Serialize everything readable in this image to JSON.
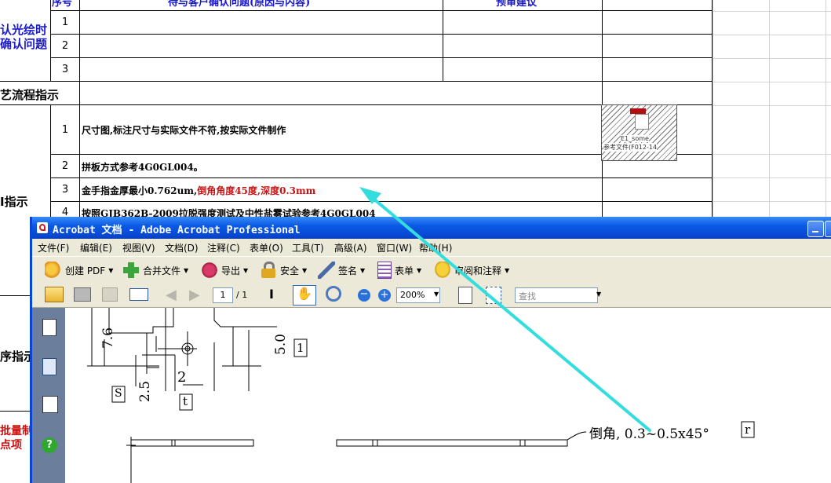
{
  "spreadsheet": {
    "header": {
      "seq_col": "序号",
      "question_col": "待与客户确认问题(原因与内容)",
      "suggestion_col": "预审建议"
    },
    "section_confirm": {
      "line1": "认光绘时",
      "line2": "确认问题"
    },
    "confirm_rows": [
      "1",
      "2",
      "3"
    ],
    "section_process": "艺流程指示",
    "process_rows": [
      {
        "num": "1",
        "text": "尺寸图,标注尺寸与实际文件不符,按实际文件制作"
      },
      {
        "num": "2",
        "text": "拼板方式参考4G0GL004。"
      },
      {
        "num": "3",
        "text_black": "金手指金厚最小0.762um,",
        "text_red": "倒角角度45度,深度0.3mm"
      },
      {
        "num": "4",
        "text": "按照GJB362B-2009拉脱强度测试及中性盐雾试验参考4G0GL004"
      }
    ],
    "section_mi": "I指示",
    "section_seq": "序指示",
    "section_batch": {
      "line1": "批量制",
      "line2": "点项"
    },
    "embedded_object": {
      "line1": "E1_some",
      "line2": "参考文件(F012-14"
    }
  },
  "acrobat": {
    "title": "Acrobat 文档 - Adobe Acrobat Professional",
    "menu": [
      "文件(F)",
      "编辑(E)",
      "视图(V)",
      "文档(D)",
      "注释(C)",
      "表单(O)",
      "工具(T)",
      "高级(A)",
      "窗口(W)",
      "帮助(H)"
    ],
    "toolbar1": [
      {
        "label": "创建 PDF",
        "icon": "create-pdf-icon"
      },
      {
        "label": "合并文件",
        "icon": "combine-files-icon"
      },
      {
        "label": "导出",
        "icon": "export-icon"
      },
      {
        "label": "安全",
        "icon": "lock-icon"
      },
      {
        "label": "签名",
        "icon": "pen-icon"
      },
      {
        "label": "表单",
        "icon": "form-icon"
      },
      {
        "label": "审阅和注释",
        "icon": "comment-icon"
      }
    ],
    "page": {
      "current": "1",
      "total": "/ 1"
    },
    "zoom": "200%",
    "find_placeholder": "查找",
    "drawing": {
      "dim_a": "7.6",
      "dim_b": "5.0",
      "dim_c": "2.5",
      "dim_d": "2",
      "label_1": "1",
      "label_s": "S",
      "label_t": "t",
      "label_r": "r",
      "chamfer_note": "倒角, 0.3~0.5x45°"
    }
  },
  "colors": {
    "title_blue": "#0a5ae6",
    "annotation_arrow": "#33dddd",
    "section_blue": "#1a1acc",
    "text_red": "#cc1111"
  }
}
